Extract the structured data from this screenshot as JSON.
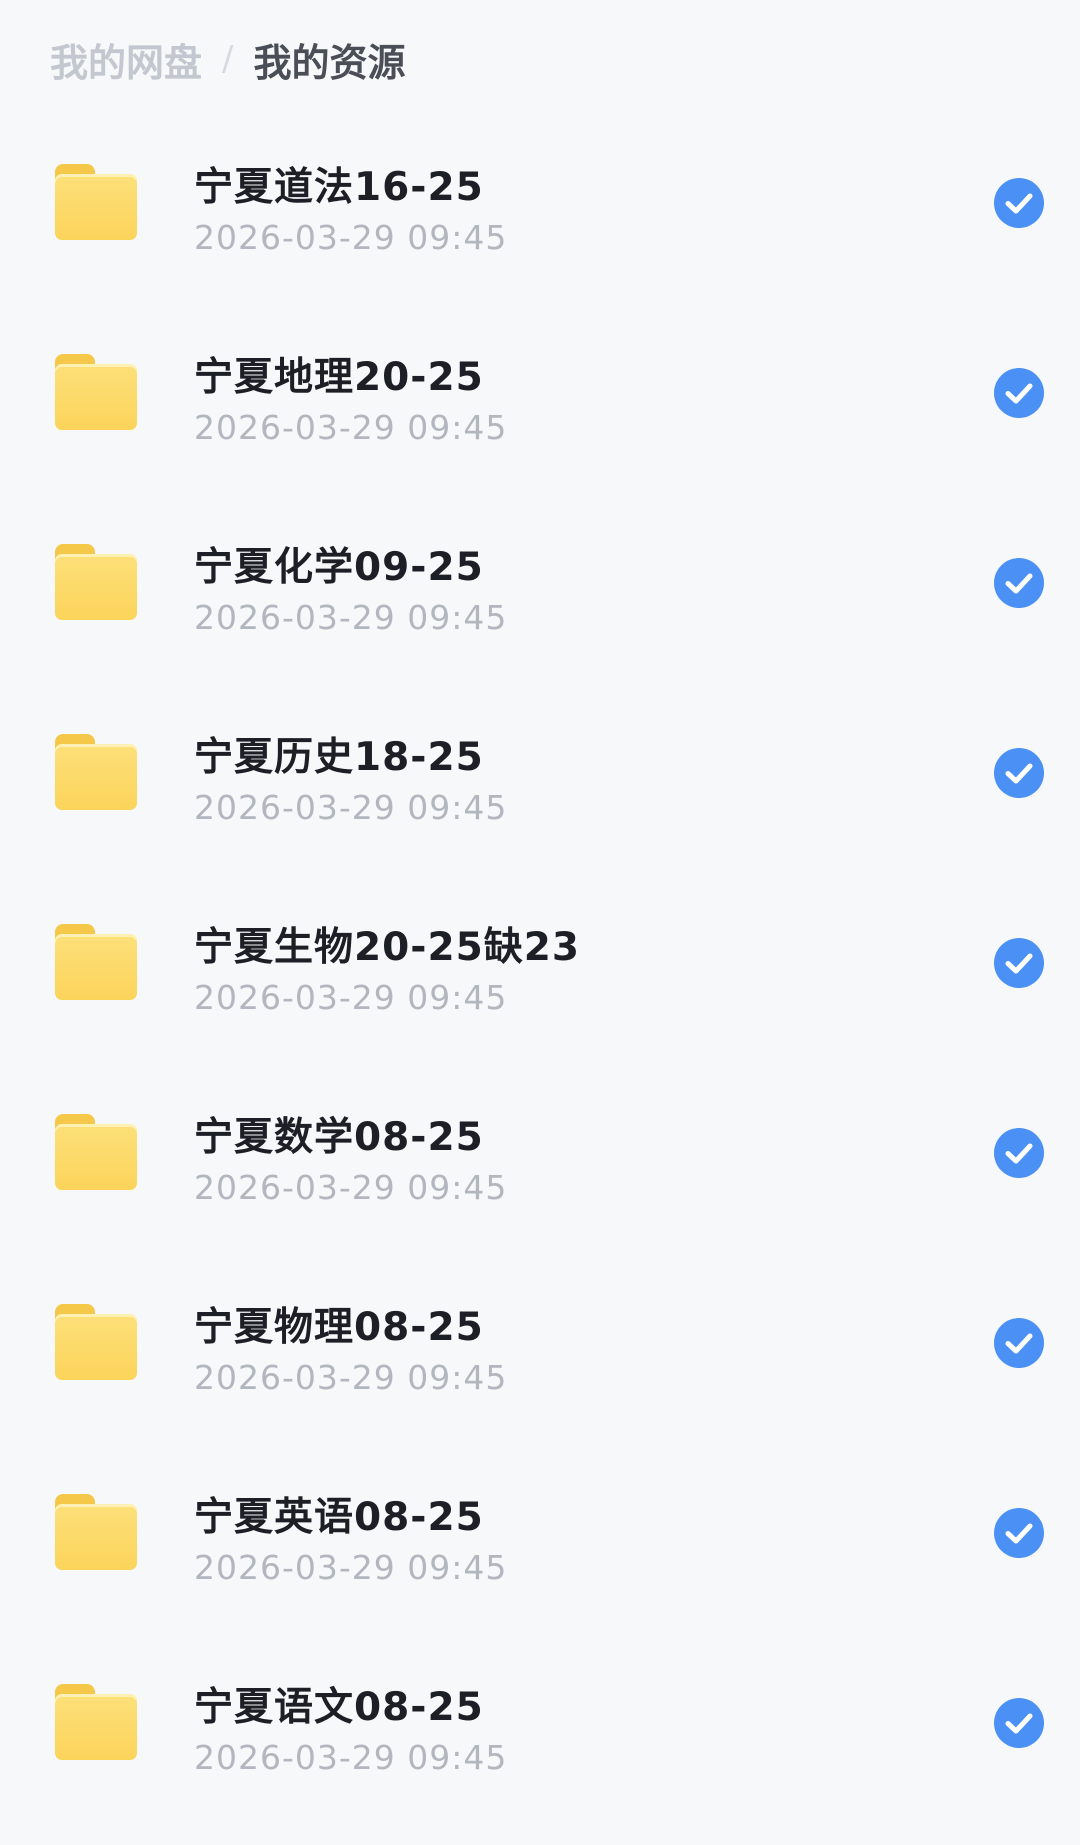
{
  "breadcrumb": {
    "root": "我的网盘",
    "separator": "/",
    "current": "我的资源"
  },
  "files": [
    {
      "name": "宁夏道法16-25",
      "time": "2026-03-29 09:45",
      "icon": "folder-icon",
      "selected": true
    },
    {
      "name": "宁夏地理20-25",
      "time": "2026-03-29 09:45",
      "icon": "folder-icon",
      "selected": true
    },
    {
      "name": "宁夏化学09-25",
      "time": "2026-03-29 09:45",
      "icon": "folder-icon",
      "selected": true
    },
    {
      "name": "宁夏历史18-25",
      "time": "2026-03-29 09:45",
      "icon": "folder-icon",
      "selected": true
    },
    {
      "name": "宁夏生物20-25缺23",
      "time": "2026-03-29 09:45",
      "icon": "folder-icon",
      "selected": true
    },
    {
      "name": "宁夏数学08-25",
      "time": "2026-03-29 09:45",
      "icon": "folder-icon",
      "selected": true
    },
    {
      "name": "宁夏物理08-25",
      "time": "2026-03-29 09:45",
      "icon": "folder-icon",
      "selected": true
    },
    {
      "name": "宁夏英语08-25",
      "time": "2026-03-29 09:45",
      "icon": "folder-icon",
      "selected": true
    },
    {
      "name": "宁夏语文08-25",
      "time": "2026-03-29 09:45",
      "icon": "folder-icon",
      "selected": true
    }
  ],
  "colors": {
    "accent": "#4a90f5",
    "folder": "#fbd45a",
    "background": "#f7f8fa"
  }
}
